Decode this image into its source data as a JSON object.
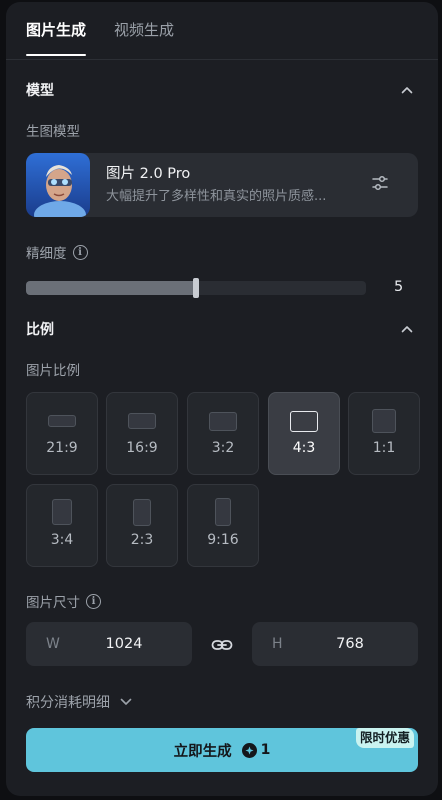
{
  "tabs": [
    {
      "label": "图片生成",
      "active": true
    },
    {
      "label": "视频生成",
      "active": false
    }
  ],
  "model_section": {
    "title": "模型",
    "sub_label": "生图模型",
    "model": {
      "name": "图片 2.0 Pro",
      "description": "大幅提升了多样性和真实的照片质感..."
    }
  },
  "precision": {
    "label": "精细度",
    "value": "5",
    "fill_fraction": 0.5
  },
  "ratio_section": {
    "title": "比例",
    "sub_label": "图片比例",
    "options": [
      {
        "label": "21:9",
        "selected": false
      },
      {
        "label": "16:9",
        "selected": false
      },
      {
        "label": "3:2",
        "selected": false
      },
      {
        "label": "4:3",
        "selected": true
      },
      {
        "label": "1:1",
        "selected": false
      },
      {
        "label": "3:4",
        "selected": false
      },
      {
        "label": "2:3",
        "selected": false
      },
      {
        "label": "9:16",
        "selected": false
      }
    ]
  },
  "size": {
    "label": "图片尺寸",
    "width_prefix": "W",
    "width_value": "1024",
    "height_prefix": "H",
    "height_value": "768"
  },
  "cost_details": {
    "label": "积分消耗明细"
  },
  "generate": {
    "label": "立即生成",
    "credits": "1",
    "promo_badge": "限时优惠"
  },
  "colors": {
    "accent": "#5fc5dc",
    "panel_bg": "#1c1e23",
    "card_bg": "#2a2d33",
    "promo_bg": "#c9f3f0"
  }
}
